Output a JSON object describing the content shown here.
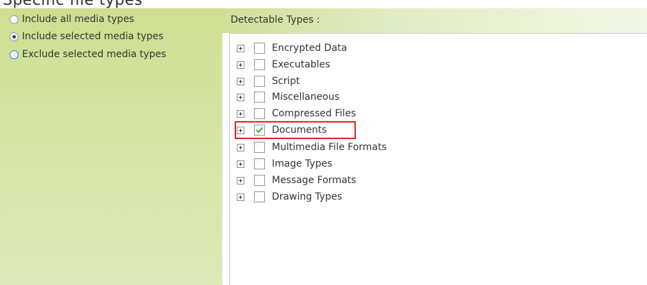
{
  "section_title": "Specific file types",
  "media_options": [
    {
      "label": "Include all media types",
      "checked": false
    },
    {
      "label": "Include selected media types",
      "checked": true
    },
    {
      "label": "Exclude selected media types",
      "checked": false
    }
  ],
  "detectable_header": "Detectable Types :",
  "types": [
    {
      "label": "Encrypted Data",
      "checked": false
    },
    {
      "label": "Executables",
      "checked": false
    },
    {
      "label": "Script",
      "checked": false
    },
    {
      "label": "Miscellaneous",
      "checked": false
    },
    {
      "label": "Compressed Files",
      "checked": false
    },
    {
      "label": "Documents",
      "checked": true,
      "highlighted": true
    },
    {
      "label": "Multimedia File Formats",
      "checked": false
    },
    {
      "label": "Image Types",
      "checked": false
    },
    {
      "label": "Message Formats",
      "checked": false
    },
    {
      "label": "Drawing Types",
      "checked": false
    }
  ],
  "icons": {
    "expand": "expand-plus-icon",
    "check": "checkmark-icon"
  },
  "colors": {
    "panel_green": "#cddf8f",
    "highlight_red": "#e02020",
    "check_green": "#3f9a2a"
  }
}
